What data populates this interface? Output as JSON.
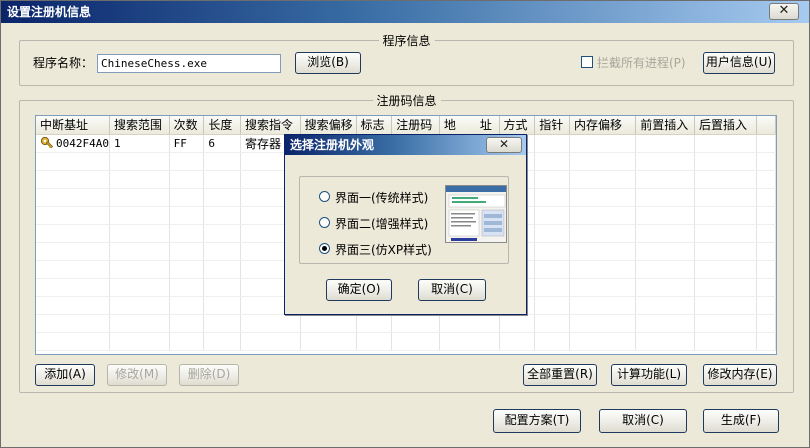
{
  "window": {
    "title": "设置注册机信息",
    "close_label": "✕"
  },
  "program_info": {
    "group_title": "程序信息",
    "name_label": "程序名称：",
    "name_value": "ChineseChess.exe",
    "browse_button": "浏览(B)",
    "block_all_label": "拦截所有进程(P)",
    "user_info_button": "用户信息(U)"
  },
  "reg_info": {
    "group_title": "注册码信息",
    "columns": [
      "中断基址",
      "搜索范围",
      "次数",
      "长度",
      "搜索指令",
      "搜索偏移",
      "标志",
      "注册码",
      "地　　址",
      "方式",
      "指针",
      "内存偏移",
      "前置插入",
      "后置插入"
    ],
    "rows": [
      [
        "0042F4A0",
        "1",
        "FF",
        "6",
        "寄存器",
        "",
        "",
        "",
        "",
        "",
        "",
        "",
        "",
        ""
      ]
    ],
    "buttons": {
      "add": "添加(A)",
      "modify": "修改(M)",
      "delete": "删除(D)",
      "reset_all": "全部重置(R)",
      "calc": "计算功能(L)",
      "modify_mem": "修改内存(E)"
    }
  },
  "footer": {
    "config": "配置方案(T)",
    "cancel": "取消(C)",
    "generate": "生成(F)"
  },
  "dialog": {
    "title": "选择注册机外观",
    "close_label": "✕",
    "options": [
      "界面一(传统样式)",
      "界面二(增强样式)",
      "界面三(仿XP样式)"
    ],
    "selected_index": 2,
    "ok": "确定(O)",
    "cancel": "取消(C)"
  },
  "colors": {
    "titlebar": "#0a246a",
    "face": "#ece9d8",
    "border": "#7f9db9"
  }
}
